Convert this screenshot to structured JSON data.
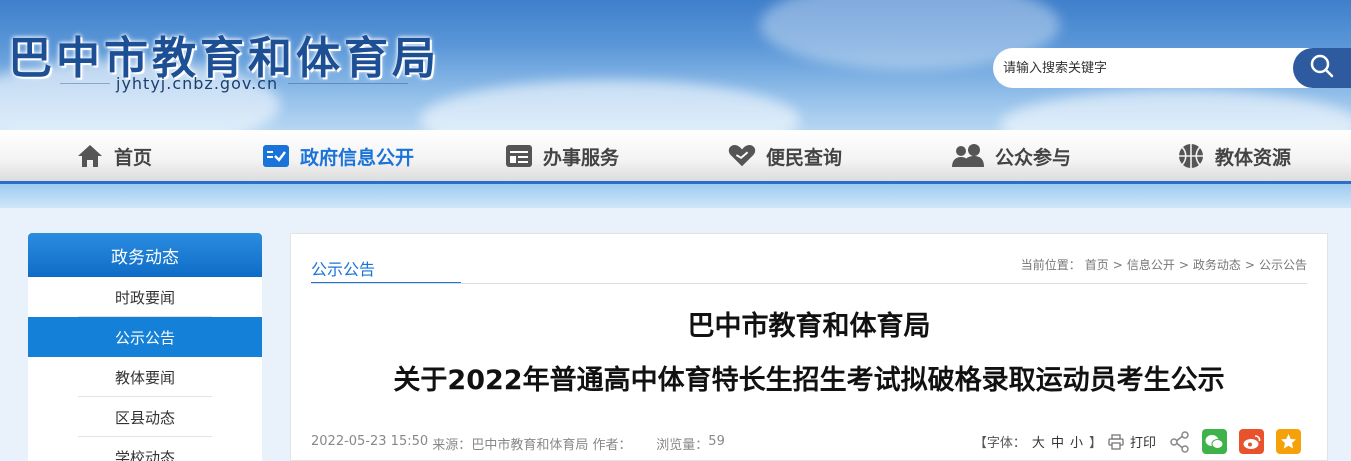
{
  "header": {
    "site_title": "巴中市教育和体育局",
    "site_domain": "jyhtyj.cnbz.gov.cn",
    "search_placeholder": "请输入搜索关键字"
  },
  "nav": {
    "items": [
      {
        "label": "首页",
        "icon": "home-icon"
      },
      {
        "label": "政府信息公开",
        "icon": "checklist-icon",
        "active": true
      },
      {
        "label": "办事服务",
        "icon": "service-card-icon"
      },
      {
        "label": "便民查询",
        "icon": "heart-hand-icon"
      },
      {
        "label": "公众参与",
        "icon": "people-icon"
      },
      {
        "label": "教体资源",
        "icon": "basketball-icon"
      }
    ]
  },
  "sidebar": {
    "title": "政务动态",
    "items": [
      {
        "label": "时政要闻"
      },
      {
        "label": "公示公告",
        "active": true
      },
      {
        "label": "教体要闻"
      },
      {
        "label": "区县动态"
      },
      {
        "label": "学校动态"
      }
    ]
  },
  "content": {
    "tab": "公示公告",
    "breadcrumb": {
      "prefix": "当前位置：",
      "items": [
        "首页",
        "信息公开",
        "政务动态",
        "公示公告"
      ],
      "separator": ">"
    },
    "title_line1": "巴中市教育和体育局",
    "title_line2": "关于2022年普通高中体育特长生招生考试拟破格录取运动员考生公示",
    "meta": {
      "date": "2022-05-23 15:50",
      "source_label": "来源：",
      "source": "巴中市教育和体育局",
      "author_label": "作者：",
      "views_label": "浏览量：",
      "views": "59"
    },
    "tools": {
      "font_label": "【字体：",
      "size_large": "大",
      "size_medium": "中",
      "size_small": "小",
      "font_end": "】",
      "print": "打印"
    }
  },
  "colors": {
    "brand_blue": "#1a73d8",
    "sidebar_active": "#1480d8",
    "wechat": "#3db34a",
    "weibo": "#e8522d",
    "favorite": "#f5a20a"
  }
}
